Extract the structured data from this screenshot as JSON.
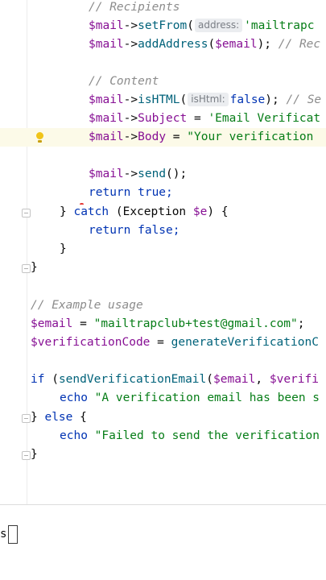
{
  "editor": {
    "lines": {
      "recipients_comment": "// Recipients",
      "setfrom_var": "$mail",
      "setfrom_arrow": "->",
      "setfrom_fn": "setFrom",
      "setfrom_paren": "(",
      "setfrom_hint": "address:",
      "setfrom_str": "'mailtrapc",
      "addaddress_var": "$mail",
      "addaddress_arrow": "->",
      "addaddress_fn": "addAddress",
      "addaddress_paren": "(",
      "addaddress_arg": "$email",
      "addaddress_close": ");",
      "addaddress_comment": "// Rec",
      "content_comment": "// Content",
      "ishtml_var": "$mail",
      "ishtml_arrow": "->",
      "ishtml_fn": "isHTML",
      "ishtml_paren": "(",
      "ishtml_hint": "isHtml:",
      "ishtml_val": "false",
      "ishtml_close": ");",
      "ishtml_comment": "// Se",
      "subject_var": "$mail",
      "subject_arrow": "->",
      "subject_prop": "Subject",
      "subject_eq": " = ",
      "subject_str": "'Email Verificat",
      "body_var": "$mail",
      "body_arrow": "->",
      "body_prop": "Body",
      "body_eq": " = ",
      "body_str": "\"Your verification",
      "send_var": "$mail",
      "send_arrow": "->",
      "send_fn": "send",
      "send_close": "();",
      "return_kw": "return",
      "return_true": " true;",
      "catch_open": "} ",
      "catch_kw": "catch",
      "catch_paren": " (Exception ",
      "catch_var": "$e",
      "catch_close": ") {",
      "return2_kw": "return",
      "return2_false": " false;",
      "brace_close_inner": "}",
      "brace_close_fn": "}",
      "example_comment": "// Example usage",
      "email_var": "$email",
      "email_eq": " = ",
      "email_str": "\"mailtrapclub+test@gmail.com\"",
      "email_end": ";",
      "vcode_var": "$verificationCode",
      "vcode_eq": " = ",
      "vcode_fn": "generateVerificationC",
      "if_kw": "if",
      "if_paren": " (",
      "if_fn": "sendVerificationEmail",
      "if_open": "(",
      "if_arg1": "$email",
      "if_comma": ", ",
      "if_arg2": "$verifi",
      "echo1_kw": "echo",
      "echo1_str": " \"A verification email has been s",
      "else_open": "} ",
      "else_kw": "else",
      "else_brace": " {",
      "echo2_kw": "echo",
      "echo2_str": " \"Failed to send the verification",
      "final_brace": "}"
    }
  },
  "terminal": {
    "prompt_char": "s"
  }
}
